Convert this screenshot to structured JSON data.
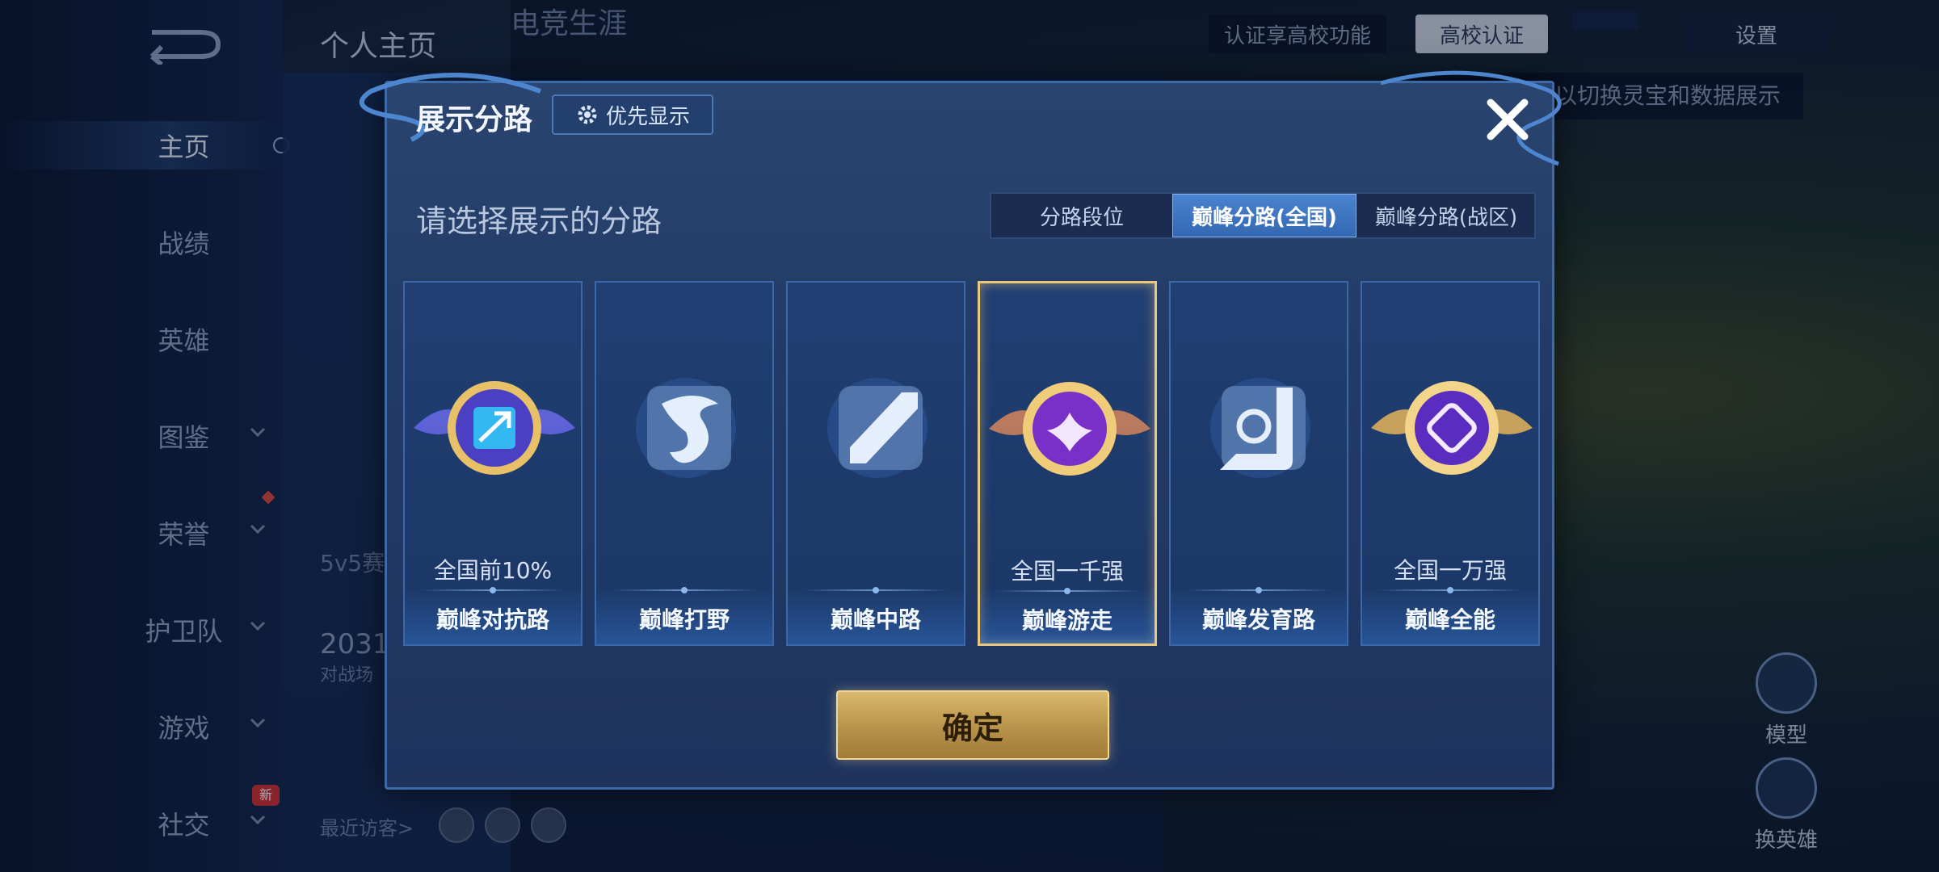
{
  "sidebar": {
    "items": [
      {
        "label": "主页"
      },
      {
        "label": "战绩"
      },
      {
        "label": "英雄"
      },
      {
        "label": "图鉴"
      },
      {
        "label": "荣誉"
      },
      {
        "label": "护卫队"
      },
      {
        "label": "游戏"
      },
      {
        "label": "社交",
        "badge": "新"
      }
    ]
  },
  "header": {
    "tabs": [
      {
        "label": "个人主页"
      },
      {
        "label": "电竞生涯"
      }
    ],
    "cert_tip": "认证享高校功能",
    "cert_button": "高校认证",
    "settings": "设置",
    "hint": "以切换灵宝和数据展示"
  },
  "background": {
    "mode_text": "5v5赛",
    "number_text": "2031",
    "battle_text": "对战场",
    "visitors_label": "最近访客>",
    "right_icons": [
      {
        "label": "模型"
      },
      {
        "label": "换英雄"
      }
    ]
  },
  "modal": {
    "title": "展示分路",
    "priority_button": "优先显示",
    "subtitle": "请选择展示的分路",
    "segments": [
      {
        "label": "分路段位",
        "active": false
      },
      {
        "label": "巅峰分路(全国)",
        "active": true
      },
      {
        "label": "巅峰分路(战区)",
        "active": false
      }
    ],
    "cards": [
      {
        "name": "巅峰对抗路",
        "rank": "全国前10%",
        "icon": "clash-lane-emblem-icon",
        "selected": false
      },
      {
        "name": "巅峰打野",
        "rank": "",
        "icon": "jungle-dragon-icon",
        "selected": false
      },
      {
        "name": "巅峰中路",
        "rank": "",
        "icon": "mid-lane-icon",
        "selected": false
      },
      {
        "name": "巅峰游走",
        "rank": "全国一千强",
        "icon": "roam-emblem-icon",
        "selected": true
      },
      {
        "name": "巅峰发育路",
        "rank": "",
        "icon": "farm-lane-icon",
        "selected": false
      },
      {
        "name": "巅峰全能",
        "rank": "全国一万强",
        "icon": "allround-emblem-icon",
        "selected": false
      }
    ],
    "confirm_button": "确定"
  },
  "colors": {
    "accent_blue": "#3468b3",
    "selected_gold": "#e9c77b",
    "confirm_gold": "#c7a257",
    "modal_bg": "#223a66"
  }
}
